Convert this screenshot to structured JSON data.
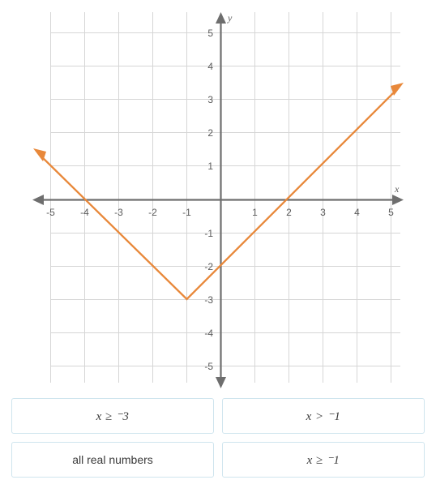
{
  "chart_data": {
    "type": "line",
    "title": "",
    "xlabel": "x",
    "ylabel": "y",
    "xlim": [
      -5.5,
      5.5
    ],
    "ylim": [
      -5.5,
      5.5
    ],
    "grid": true,
    "legend": "none",
    "x_ticks": [
      "-5",
      "-4",
      "-3",
      "-2",
      "-1",
      "1",
      "2",
      "3",
      "4",
      "5"
    ],
    "y_ticks": [
      "5",
      "4",
      "3",
      "2",
      "1",
      "-1",
      "-2",
      "-3",
      "-4",
      "-5"
    ],
    "series": [
      {
        "name": "absolute value function",
        "color": "#e8883a",
        "vertex": [
          -1,
          -3
        ],
        "x_intercepts": [
          -4,
          2
        ],
        "y_intercept": -2,
        "left_slope": -1,
        "right_slope": 1,
        "arrow_start": [
          -5.4,
          1.4
        ],
        "arrow_end": [
          5.4,
          3.4
        ],
        "points": [
          [
            -5.4,
            1.4
          ],
          [
            -1,
            -3
          ],
          [
            5.4,
            3.4
          ]
        ]
      }
    ],
    "axis_color": "#6e6e6e",
    "grid_color": "#d4d4d4"
  },
  "answers": {
    "options": [
      {
        "label": "x ≥ ⁻3",
        "style": "math"
      },
      {
        "label": "x > ⁻1",
        "style": "math"
      },
      {
        "label": "all real numbers",
        "style": "plain"
      },
      {
        "label": "x ≥ ⁻1",
        "style": "math"
      }
    ]
  }
}
